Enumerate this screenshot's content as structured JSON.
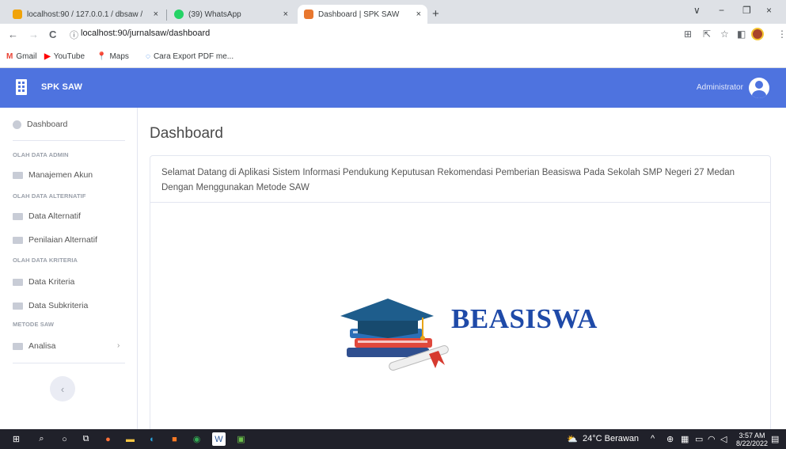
{
  "browser": {
    "tabs": [
      {
        "title": "localhost:90 / 127.0.0.1 / dbsaw /",
        "close": "×"
      },
      {
        "title": "(39) WhatsApp",
        "close": "×"
      },
      {
        "title": "Dashboard | SPK SAW",
        "close": "×"
      }
    ],
    "new_tab": "+",
    "window_controls": [
      "∨",
      "−",
      "❐",
      "×"
    ],
    "nav": {
      "back": "←",
      "forward": "→",
      "reload": "C"
    },
    "url": "localhost:90/jurnalsaw/dashboard",
    "info_icon": "ⓘ",
    "bookmarks": [
      {
        "label": "Gmail",
        "icon": "M",
        "color": "#ea4335"
      },
      {
        "label": "YouTube",
        "icon": "▶",
        "color": "#ff0000"
      },
      {
        "label": "Maps",
        "icon": "📍",
        "color": "#34a853"
      },
      {
        "label": "Cara Export PDF me...",
        "icon": "◌",
        "color": "#1a73e8"
      }
    ]
  },
  "app": {
    "brand": "SPK SAW",
    "user": "Administrator",
    "accent": "#4e73df"
  },
  "sidebar": {
    "dashboard": "Dashboard",
    "sections": [
      {
        "heading": "OLAH DATA ADMIN",
        "items": [
          "Manajemen Akun"
        ]
      },
      {
        "heading": "OLAH DATA ALTERNATIF",
        "items": [
          "Data Alternatif",
          "Penilaian Alternatif"
        ]
      },
      {
        "heading": "OLAH DATA KRITERIA",
        "items": [
          "Data Kriteria",
          "Data Subkriteria"
        ]
      },
      {
        "heading": "METODE SAW",
        "items": [
          "Analisa"
        ]
      }
    ],
    "toggle": "‹",
    "chevron": "›"
  },
  "main": {
    "title": "Dashboard",
    "welcome": "Selamat Datang di Aplikasi Sistem Informasi Pendukung Keputusan Rekomendasi Pemberian Beasiswa Pada Sekolah SMP Negeri 27 Medan Dengan Menggunakan Metode SAW",
    "logo_text": "BEASISWA"
  },
  "taskbar": {
    "weather": "24°C Berawan",
    "time": "3:57 AM",
    "date": "8/22/2022"
  }
}
